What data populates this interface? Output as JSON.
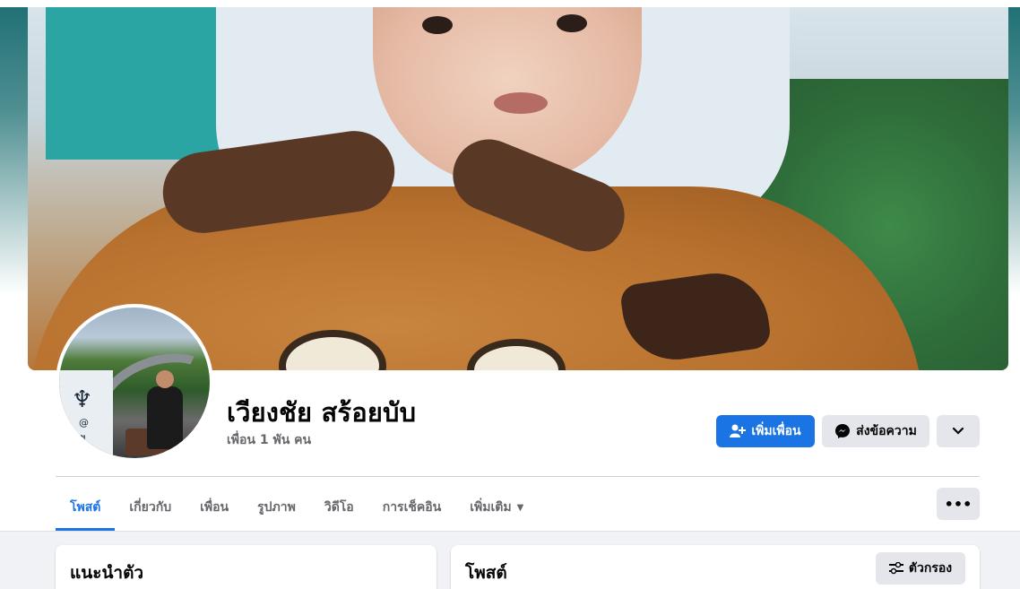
{
  "profile": {
    "name": "เวียงชัย สร้อยบับ",
    "friends": "เพื่อน 1 พัน คน",
    "avatar_text": {
      "at": "@",
      "sign": "นเลข"
    }
  },
  "actions": {
    "add_friend": "เพิ่มเพื่อน",
    "message": "ส่งข้อความ"
  },
  "tabs": [
    {
      "label": "โพสต์",
      "active": true
    },
    {
      "label": "เกี่ยวกับ"
    },
    {
      "label": "เพื่อน"
    },
    {
      "label": "รูปภาพ"
    },
    {
      "label": "วิดีโอ"
    },
    {
      "label": "การเช็คอิน"
    },
    {
      "label": "เพิ่มเติม"
    }
  ],
  "cards": {
    "intro_title": "แนะนำตัว",
    "posts_title": "โพสต์",
    "filter_label": "ตัวกรอง"
  },
  "colors": {
    "primary": "#1b74e4",
    "secondary_bg": "#e4e6eb",
    "page_bg": "#f0f2f5"
  }
}
